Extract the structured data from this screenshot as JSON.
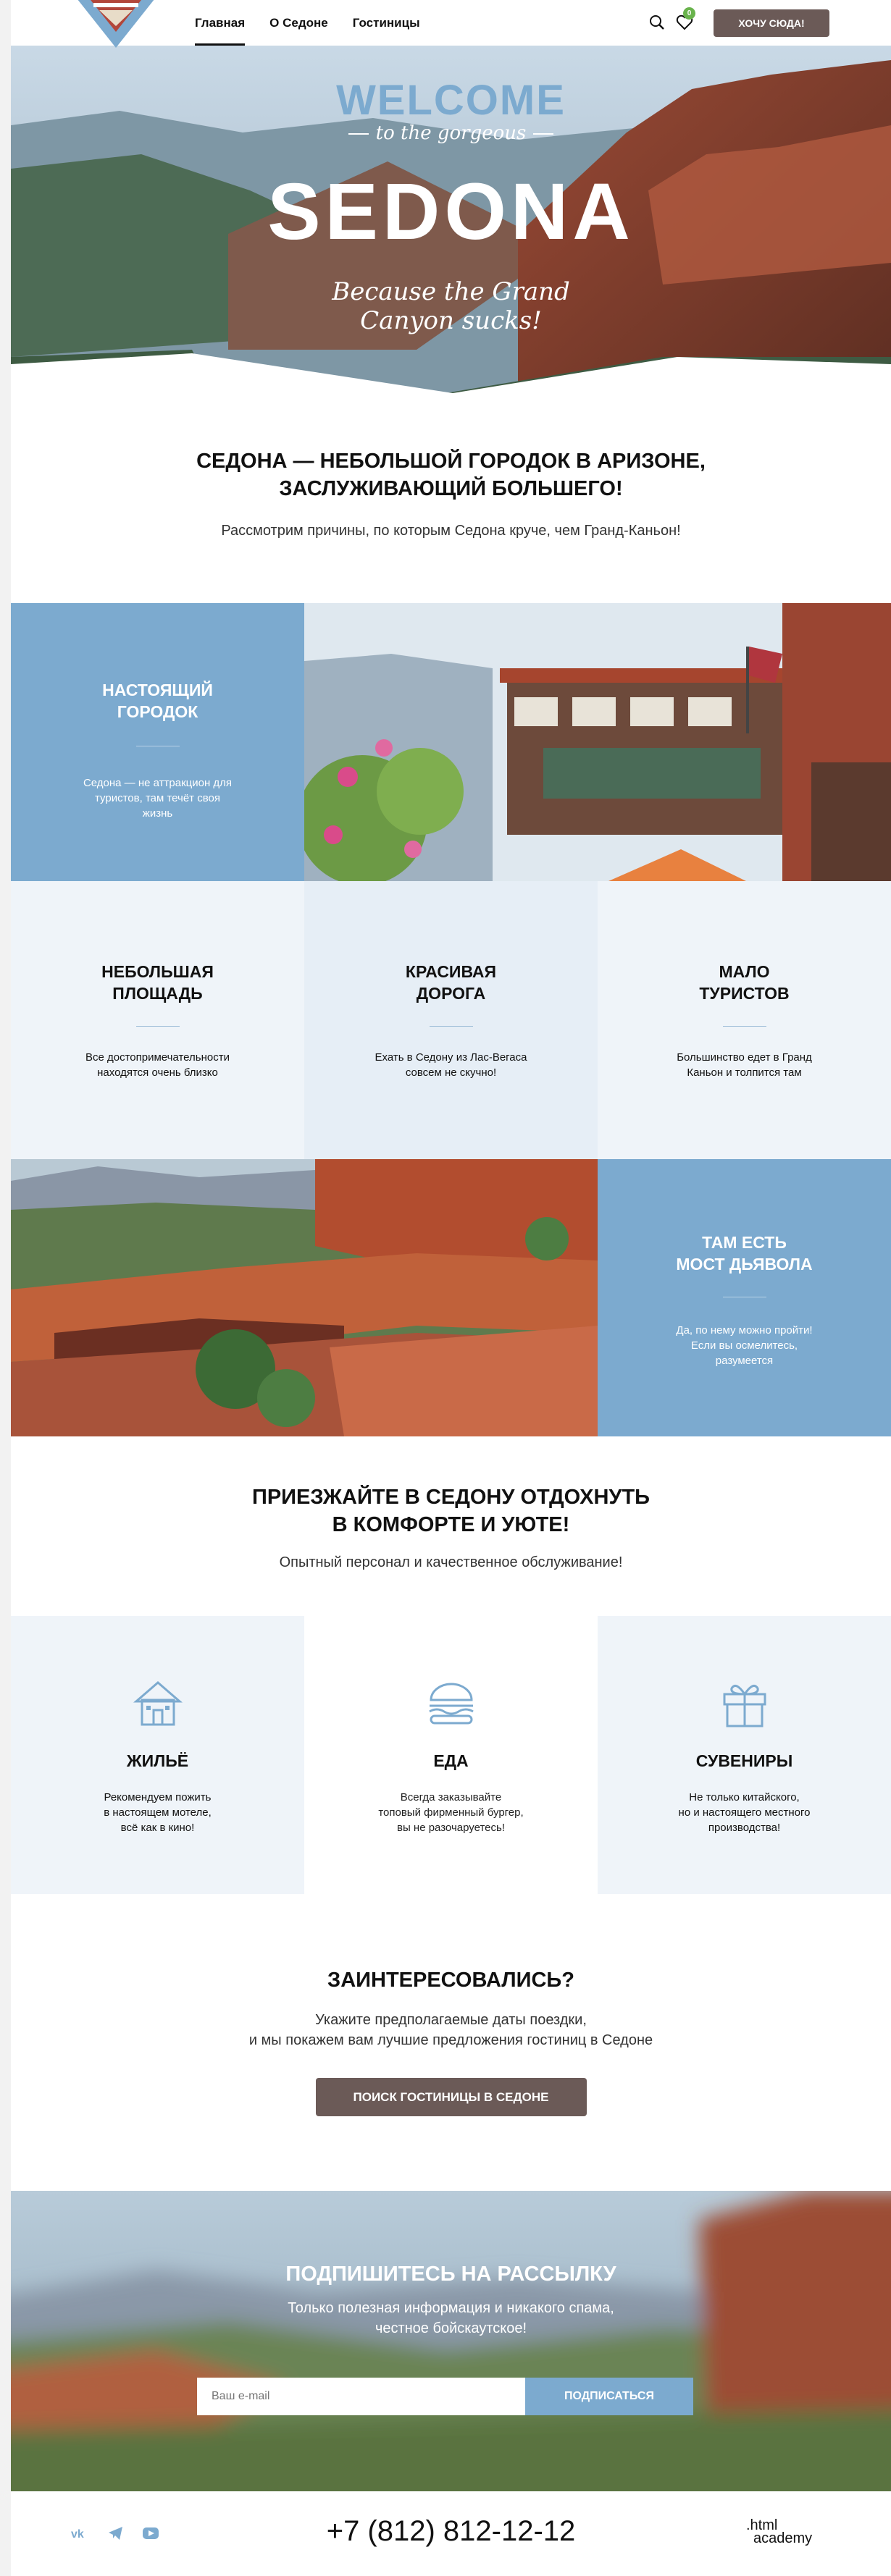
{
  "header": {
    "nav": [
      {
        "label": "Главная"
      },
      {
        "label": "О Седоне"
      },
      {
        "label": "Гостиницы"
      }
    ],
    "cart_count": "0",
    "want_button": "Хочу сюда!"
  },
  "hero": {
    "welcome": "WELCOME",
    "to_the": "to the gorgeous",
    "city": "SEDONA",
    "quote_line1": "Because the Grand",
    "quote_line2": "Canyon sucks!"
  },
  "intro": {
    "title_line1": "Седона — небольшой городок в Аризоне,",
    "title_line2": "заслуживающий большего!",
    "subtitle": "Рассмотрим причины, по которым Седона круче, чем Гранд-Каньон!"
  },
  "reasons": [
    {
      "title1": "Настоящий",
      "title2": "городок",
      "desc1": "Седона — не аттракцион для",
      "desc2": "туристов, там течёт своя",
      "desc3": "жизнь"
    },
    {
      "title1": "Небольшая",
      "title2": "площадь",
      "desc1": "Все достопримечательности",
      "desc2": "находятся очень близко"
    },
    {
      "title1": "Красивая",
      "title2": "дорога",
      "desc1": "Ехать в Седону из Лас-Вегаса",
      "desc2": "совсем не скучно!"
    },
    {
      "title1": "Мало",
      "title2": "туристов",
      "desc1": "Большинство едет в Гранд",
      "desc2": "Каньон и толпится там"
    },
    {
      "title1": "Там есть",
      "title2": "мост дьявола",
      "desc1": "Да, по нему можно пройти!",
      "desc2": "Если вы осмелитесь,",
      "desc3": "разумеется"
    }
  ],
  "comfort": {
    "title_line1": "Приезжайте в Седону отдохнуть",
    "title_line2": "в комфорте и уюте!",
    "subtitle": "Опытный персонал и качественное обслуживание!"
  },
  "features": [
    {
      "icon": "house-icon",
      "title": "Жильё",
      "desc1": "Рекомендуем пожить",
      "desc2": "в настоящем мотеле,",
      "desc3": "всё как в кино!"
    },
    {
      "icon": "burger-icon",
      "title": "Еда",
      "desc1": "Всегда заказывайте",
      "desc2": "топовый фирменный бургер,",
      "desc3": "вы не разочаруетесь!"
    },
    {
      "icon": "gift-icon",
      "title": "Сувениры",
      "desc1": "Не только китайского,",
      "desc2": "но и настоящего местного",
      "desc3": "производства!"
    }
  ],
  "interest": {
    "title": "Заинтересовались?",
    "line1": "Укажите предполагаемые даты поездки,",
    "line2": "и мы покажем вам лучшие предложения гостиниц в Седоне",
    "button": "Поиск гостиницы в Седоне"
  },
  "subscribe": {
    "title": "Подпишитесь на рассылку",
    "line1": "Только полезная информация и никакого спама,",
    "line2": "честное бойскаутское!",
    "placeholder": "Ваш e-mail",
    "button": "Подписаться"
  },
  "footer": {
    "phone": "+7 (812) 812-12-12",
    "brand_line1": ".html",
    "brand_line2": "academy"
  },
  "colors": {
    "accent_blue": "#7caacf",
    "button_brown": "#6b5a57",
    "pale_blue": "#eff4f9",
    "badge_green": "#69b34c"
  }
}
